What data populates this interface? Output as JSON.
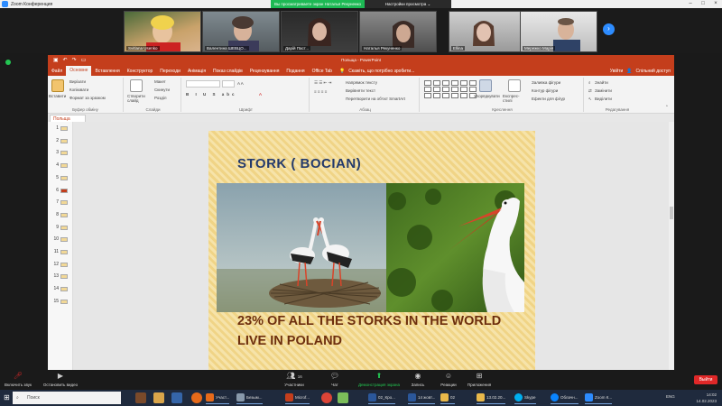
{
  "zoom": {
    "window_title": "Zoom Конференция",
    "share_banner": "Вы просматриваете экран Наталья Рекуненко",
    "view_options": "Настройки просмотра ⌄",
    "participants": [
      {
        "name": "Svitlana Usenko"
      },
      {
        "name": "Валентина ШЕВЦО..."
      },
      {
        "name": "Дарій Паст..."
      },
      {
        "name": "Наталья Рекуненко"
      },
      {
        "name": "Ellina"
      },
      {
        "name": "Мережко Марія"
      }
    ],
    "controls": [
      {
        "label": "Включить звук",
        "icon": "microphone-muted-icon"
      },
      {
        "label": "Остановить видео",
        "icon": "video-camera-icon"
      },
      {
        "label": "Участники",
        "icon": "participants-icon",
        "count": "16"
      },
      {
        "label": "Чат",
        "icon": "chat-icon"
      },
      {
        "label": "Демонстрация экрана",
        "icon": "share-screen-icon"
      },
      {
        "label": "Запись",
        "icon": "record-icon"
      },
      {
        "label": "Реакции",
        "icon": "reactions-icon"
      },
      {
        "label": "Приложения",
        "icon": "apps-icon"
      }
    ],
    "exit_label": "Выйти"
  },
  "ppt": {
    "title": "Польща - PowerPoint",
    "tabs": [
      "Файл",
      "Основне",
      "Вставлення",
      "Конструктор",
      "Переходи",
      "Анімація",
      "Показ слайдів",
      "Рецензування",
      "Подання",
      "Office Tab"
    ],
    "tell_me": "Скажіть, що потрібно зробити...",
    "login": "Увійти",
    "share": "Спільний доступ",
    "ribbon": {
      "clipboard": {
        "label": "Буфер обміну",
        "paste": "Вставити",
        "cut": "Вирізати",
        "copy": "Копіювати",
        "format_painter": "Формат за зразком"
      },
      "slides": {
        "label": "Слайди",
        "new_slide": "Створити слайд",
        "layout": "Макет",
        "reset": "Скинути",
        "section": "Розділ"
      },
      "font": {
        "label": "Шрифт"
      },
      "paragraph": {
        "label": "Абзац",
        "direction": "Напрямок тексту",
        "align": "Вирівняти текст",
        "smartart": "Перетворити на об'єкт SmartArt"
      },
      "drawing": {
        "label": "Креслення",
        "arrange": "Упорядкувати",
        "quick_styles": "Експрес-стилі",
        "fill": "Заливка фігури",
        "outline": "Контур фігури",
        "effects": "Ефекти для фігур"
      },
      "editing": {
        "label": "Редагування",
        "find": "Знайти",
        "replace": "Замінити",
        "select": "Виділити"
      }
    },
    "doc_tab": "Польща",
    "slide_numbers": [
      "1",
      "2",
      "3",
      "4",
      "5",
      "6",
      "7",
      "8",
      "9",
      "10",
      "11",
      "12",
      "13",
      "14",
      "15"
    ],
    "selected_slide": "6",
    "slide": {
      "title": "STORK ( BOCIAN)",
      "text": "23% OF ALL THE STORKS IN THE WORLD LIVE IN POLAND"
    }
  },
  "taskbar": {
    "search": "Поиск",
    "apps": [
      {
        "label": "Участ..."
      },
      {
        "label": "Безым..."
      },
      {
        "label": "Microf..."
      },
      {
        "label": "02_Кро..."
      },
      {
        "label": "14 жовт..."
      },
      {
        "label": "02"
      },
      {
        "label": "13.02.20..."
      },
      {
        "label": "Skype"
      },
      {
        "label": "Облачн..."
      },
      {
        "label": "Zoom К..."
      }
    ],
    "lang": "ENG",
    "time": "14:02",
    "date": "14.02.2023"
  },
  "colors": {
    "ppt_accent": "#c43e1c",
    "zoom_blue": "#2d8cff",
    "share_green": "#1db954",
    "slide_title": "#243a6b",
    "slide_text": "#6d2f0e"
  }
}
